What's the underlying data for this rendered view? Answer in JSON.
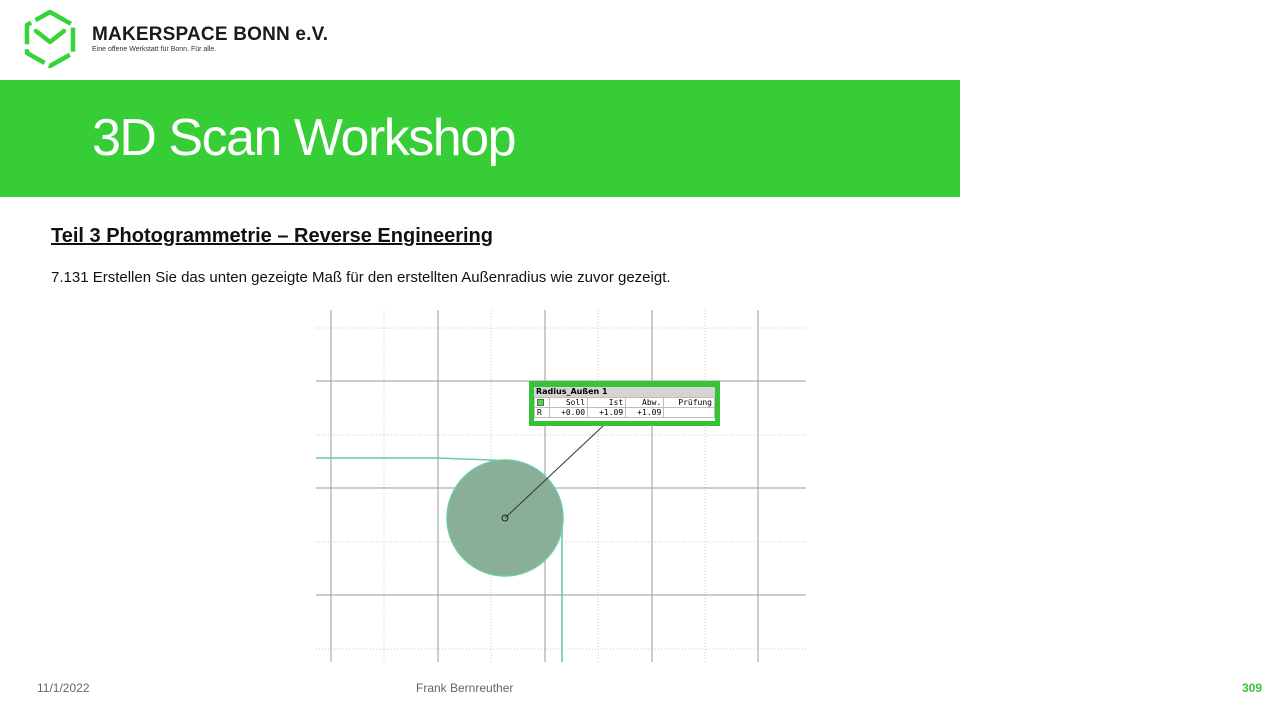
{
  "header": {
    "org_name": "MAKERSPACE BONN e.V.",
    "org_tagline": "Eine offene Werkstatt für Bonn. Für alle.",
    "logo_icon": "hexagon-m-logo-icon",
    "brand_color": "#36cd36"
  },
  "banner": {
    "title": "3D Scan Workshop"
  },
  "content": {
    "section_title": "Teil 3  Photogrammetrie  – Reverse Engineering",
    "instruction": "7.131 Erstellen Sie das unten gezeigte Maß für den erstellten Außenradius wie zuvor gezeigt."
  },
  "dimension_label": {
    "title": "Radius_Außen 1",
    "columns": [
      "Soll",
      "Ist",
      "Abw.",
      "Prüfung"
    ],
    "row": {
      "name": "R",
      "soll": "+0.00",
      "ist": "+1.09",
      "abw": "+1.09",
      "pruefung": ""
    }
  },
  "footer": {
    "date": "11/1/2022",
    "author": "Frank Bernreuther",
    "page_number": "309"
  }
}
